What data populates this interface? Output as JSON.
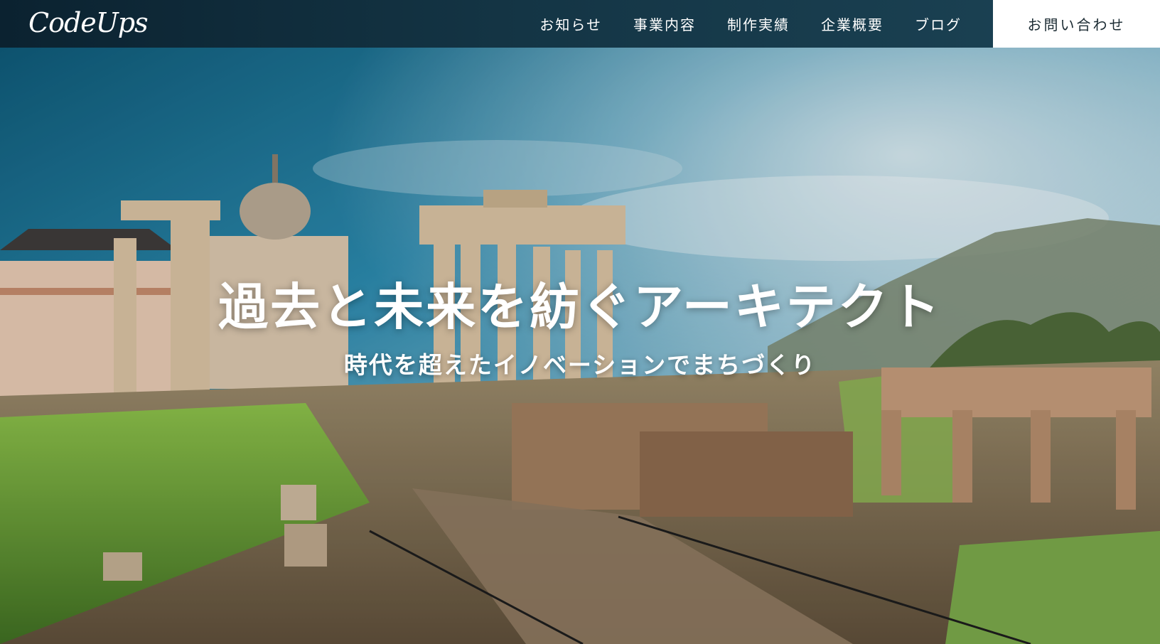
{
  "brand": {
    "logo_text": "CodeUps"
  },
  "nav": {
    "items": [
      {
        "label": "お知らせ"
      },
      {
        "label": "事業内容"
      },
      {
        "label": "制作実績"
      },
      {
        "label": "企業概要"
      },
      {
        "label": "ブログ"
      }
    ],
    "contact_label": "お問い合わせ"
  },
  "hero": {
    "title": "過去と未来を紡ぐアーキテクト",
    "subtitle": "時代を超えたイノベーションでまちづくり",
    "image": "roman-forum-ruins-photo"
  },
  "colors": {
    "header_bg": "#0f2a38",
    "contact_bg": "#ffffff",
    "text_light": "#ffffff"
  }
}
